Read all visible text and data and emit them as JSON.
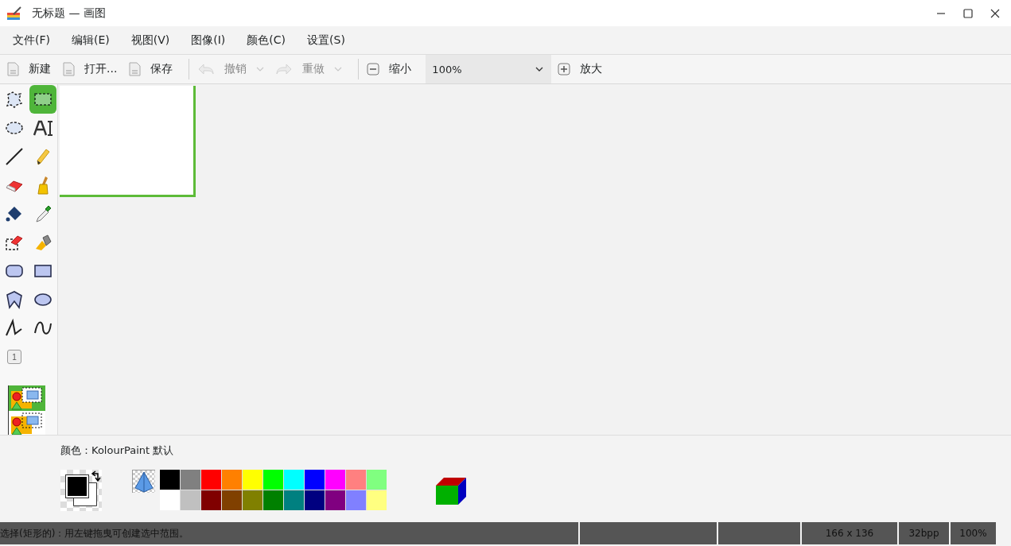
{
  "window": {
    "title": "无标题 — 画图"
  },
  "menu": [
    "文件(F)",
    "编辑(E)",
    "视图(V)",
    "图像(I)",
    "颜色(C)",
    "设置(S)"
  ],
  "toolbar": [
    {
      "kind": "new",
      "label": "新建",
      "disabled": false
    },
    {
      "kind": "open",
      "label": "打开...",
      "disabled": false
    },
    {
      "kind": "save",
      "label": "保存",
      "disabled": false
    },
    {
      "kind": "undo",
      "label": "撤销",
      "disabled": true
    },
    {
      "kind": "redo",
      "label": "重做",
      "disabled": true
    },
    {
      "kind": "zoom-out",
      "label": "缩小",
      "disabled": false
    },
    {
      "kind": "zoom-combo",
      "label": "100%",
      "disabled": false
    },
    {
      "kind": "zoom-in",
      "label": "放大",
      "disabled": false
    }
  ],
  "tools": [
    {
      "kind": "free-select",
      "selected": false
    },
    {
      "kind": "rect-select",
      "selected": true
    },
    {
      "kind": "ellipse-select",
      "selected": false
    },
    {
      "kind": "text",
      "selected": false
    },
    {
      "kind": "line",
      "selected": false
    },
    {
      "kind": "pencil",
      "selected": false
    },
    {
      "kind": "eraser",
      "selected": false
    },
    {
      "kind": "brush",
      "selected": false
    },
    {
      "kind": "fill",
      "selected": false
    },
    {
      "kind": "picker",
      "selected": false
    },
    {
      "kind": "color-eraser",
      "selected": false
    },
    {
      "kind": "spray",
      "selected": false
    },
    {
      "kind": "rounded-rect",
      "selected": false
    },
    {
      "kind": "rect",
      "selected": false
    },
    {
      "kind": "polygon",
      "selected": false
    },
    {
      "kind": "ellipse",
      "selected": false
    },
    {
      "kind": "polyline",
      "selected": false
    },
    {
      "kind": "curve",
      "selected": false
    },
    {
      "kind": "number",
      "label": "1",
      "selected": false
    }
  ],
  "tool_options": [
    {
      "kind": "opaque",
      "selected": true
    },
    {
      "kind": "transparent",
      "selected": false
    }
  ],
  "colors": {
    "label": "颜色：KolourPaint 默认",
    "swatches": [
      {
        "kind": "foreground",
        "color": "#000000"
      },
      {
        "kind": "background",
        "color": "#ffffff"
      }
    ],
    "palette": [
      {
        "color": "#000000"
      },
      {
        "color": "#808080"
      },
      {
        "color": "#ff0000"
      },
      {
        "color": "#ff8000"
      },
      {
        "color": "#ffff00"
      },
      {
        "color": "#00ff00"
      },
      {
        "color": "#00ffff"
      },
      {
        "color": "#0000ff"
      },
      {
        "color": "#ff00ff"
      },
      {
        "color": "#ff8080"
      },
      {
        "color": "#80ff80"
      },
      {
        "color": "#ffffff"
      },
      {
        "color": "#c0c0c0"
      },
      {
        "color": "#800000"
      },
      {
        "color": "#804000"
      },
      {
        "color": "#808000"
      },
      {
        "color": "#008000"
      },
      {
        "color": "#008080"
      },
      {
        "color": "#000080"
      },
      {
        "color": "#800080"
      },
      {
        "color": "#8080ff"
      },
      {
        "color": "#ffff80"
      }
    ]
  },
  "status_bar": {
    "message": "选择(矩形的)：用左键拖曳可创建选中范围。",
    "size": "166 x 136",
    "depth": "32bpp",
    "zoom": "100%"
  }
}
